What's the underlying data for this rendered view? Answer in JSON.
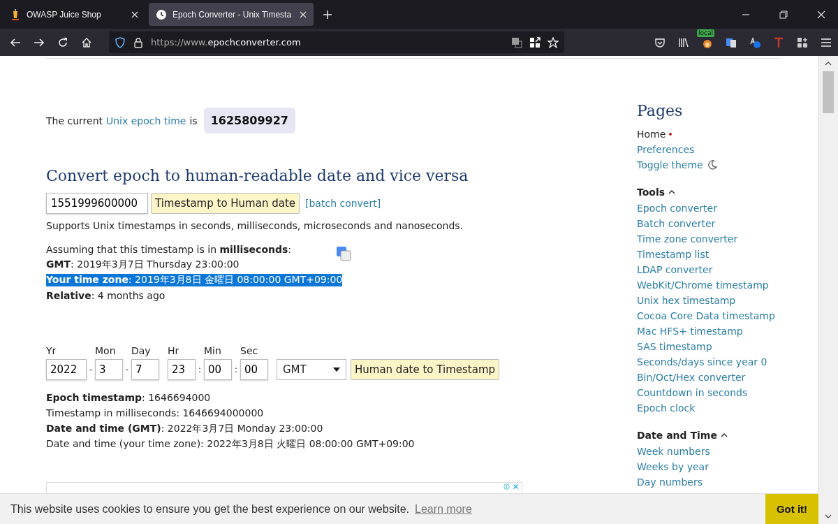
{
  "browser": {
    "tabs": [
      {
        "title": "OWASP Juice Shop",
        "selected": false
      },
      {
        "title": "Epoch Converter - Unix Timesta",
        "selected": true
      }
    ],
    "url_prefix": "https://www.",
    "url_domain": "epochconverter.com",
    "extension_badge": "local"
  },
  "current_time": {
    "prefix": "The current",
    "link": "Unix epoch time",
    "suffix": "is",
    "value": "1625809927"
  },
  "heading": "Convert epoch to human-readable date and vice versa",
  "timestamp_input": {
    "value": "1551999600000"
  },
  "convert_button": "Timestamp to Human date",
  "batch_link": "[batch convert]",
  "supports_note": "Supports Unix timestamps in seconds, milliseconds, microseconds and nanoseconds.",
  "result_lines": [
    {
      "text": "Assuming that this timestamp is in **milliseconds**:",
      "selected": false
    },
    {
      "text": "**GMT**: 2019年3月7日 Thursday 23:00:00",
      "selected": false
    },
    {
      "text": "**Your time zone**: 2019年3月8日 金曜日 08:00:00 GMT+09:00",
      "selected": true
    },
    {
      "text": "**Relative**: 4 months ago",
      "selected": false
    }
  ],
  "date_fields": [
    {
      "label": "Yr",
      "value": "2022",
      "separator": "-"
    },
    {
      "label": "Mon",
      "value": "3",
      "separator": "-"
    },
    {
      "label": "Day",
      "value": "7"
    },
    {
      "label": "Hr",
      "value": "23",
      "separator": ":"
    },
    {
      "label": "Min",
      "value": "00",
      "separator": ":"
    },
    {
      "label": "Sec",
      "value": "00"
    }
  ],
  "timezone_select": "GMT",
  "date_button": "Human date to Timestamp",
  "output_lines": [
    "**Epoch timestamp**: 1646694000",
    "Timestamp in milliseconds: 1646694000000",
    "**Date and time (GMT)**: 2022年3月7日 Monday 23:00:00",
    "Date and time (your time zone): 2022年3月8日 火曜日 08:00:00 GMT+09:00"
  ],
  "sidebar": {
    "title": "Pages",
    "top_items": [
      {
        "label": "Home",
        "current": true,
        "kind": "link"
      },
      {
        "label": "Preferences",
        "current": false,
        "kind": "link"
      },
      {
        "label": "Toggle theme",
        "current": false,
        "kind": "toggle"
      }
    ],
    "sections": [
      {
        "title": "Tools",
        "expanded": true,
        "items": [
          "Epoch converter",
          "Batch converter",
          "Time zone converter",
          "Timestamp list",
          "LDAP converter",
          "WebKit/Chrome timestamp",
          "Unix hex timestamp",
          "Cocoa Core Data timestamp",
          "Mac HFS+ timestamp",
          "SAS timestamp",
          "Seconds/days since year 0",
          "Bin/Oct/Hex converter",
          "Countdown in seconds",
          "Epoch clock"
        ]
      },
      {
        "title": "Date and Time",
        "expanded": true,
        "items": [
          "Week numbers",
          "Weeks by year",
          "Day numbers"
        ]
      }
    ]
  },
  "cookie_bar": {
    "text": "This website uses cookies to ensure you get the best experience on our website.",
    "link": "Learn more",
    "button": "Got it!"
  }
}
